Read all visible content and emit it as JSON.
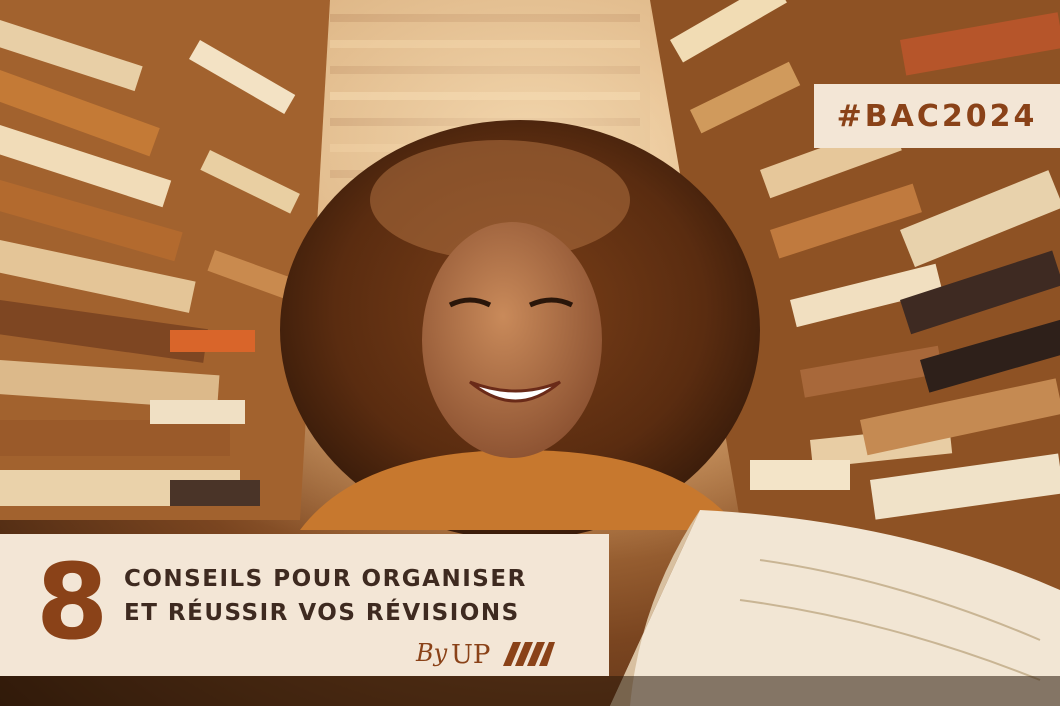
{
  "hashtag": "#BAC2024",
  "banner": {
    "number": "8",
    "line1": "CONSEILS POUR ORGANISER",
    "line2": "ET RÉUSSIR VOS RÉVISIONS",
    "by": "By",
    "logo_text": "UP"
  },
  "colors": {
    "accent": "#8a4218",
    "panel": "#f3e6d6",
    "text": "#3e2a20"
  }
}
